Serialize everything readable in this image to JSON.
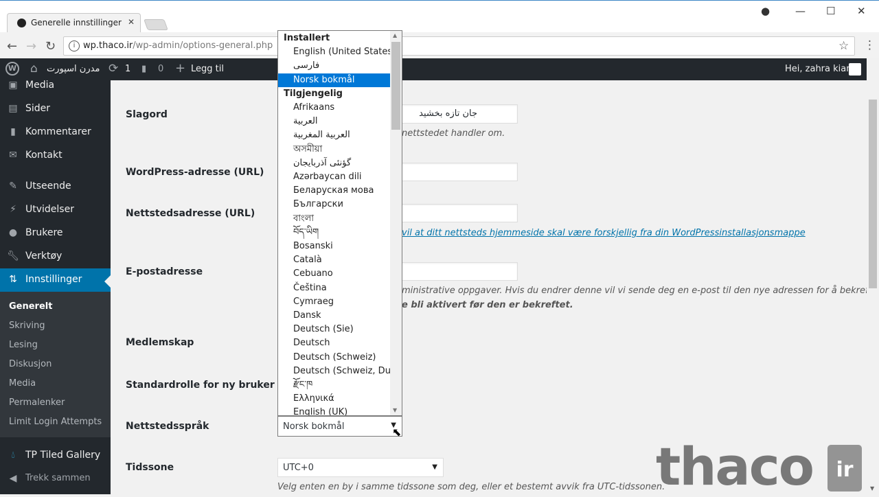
{
  "browser": {
    "tab_title": "Generelle innstillinger ‹ ",
    "url_host": "wp.thaco.ir",
    "url_path": "/wp-admin/options-general.php"
  },
  "adminbar": {
    "site_name": "مدرن اسپورت",
    "updates": "1",
    "comments": "0",
    "add_new": "Legg til",
    "greeting": "Hei, zahra kiani"
  },
  "sidebar": {
    "items": [
      {
        "label": "Media",
        "icon": "media-icon"
      },
      {
        "label": "Sider",
        "icon": "page-icon"
      },
      {
        "label": "Kommentarer",
        "icon": "comment-icon"
      },
      {
        "label": "Kontakt",
        "icon": "mail-icon"
      },
      {
        "label": "Utseende",
        "icon": "brush-icon"
      },
      {
        "label": "Utvidelser",
        "icon": "plugin-icon"
      },
      {
        "label": "Brukere",
        "icon": "user-icon"
      },
      {
        "label": "Verktøy",
        "icon": "wrench-icon"
      },
      {
        "label": "Innstillinger",
        "icon": "settings-icon"
      }
    ],
    "submenu": [
      "Generelt",
      "Skriving",
      "Lesing",
      "Diskusjon",
      "Media",
      "Permalenker",
      "Limit Login Attempts"
    ],
    "gallery": "TP Tiled Gallery",
    "collapse": "Trekk sammen"
  },
  "form": {
    "tagline_label": "Slagord",
    "tagline_value": "جان تازه بخشید",
    "tagline_desc": "nettstedet handler om.",
    "wpurl_label": "WordPress-adresse (URL)",
    "siteurl_label": "Nettstedsadresse (URL)",
    "siteurl_desc_link": "vil at ditt nettsteds hjemmeside skal være forskjellig fra din WordPressinstallasjonsmappe",
    "email_label": "E-postadresse",
    "email_desc_1": "ministrative oppgaver. Hvis du endrer denne vil vi sende deg en e-post til den nye adressen for å bekrefte",
    "email_desc_2": "e bli aktivert før den er bekreftet.",
    "membership_label": "Medlemskap",
    "role_label": "Standardrolle for ny bruker",
    "language_label": "Nettstedsspråk",
    "language_value": "Norsk bokmål",
    "timezone_label": "Tidssone",
    "timezone_value": "UTC+0",
    "timezone_desc": "Velg enten en by i samme tidssone som deg, eller et bestemt avvik fra UTC-tidssonen."
  },
  "dropdown": {
    "installed_group": "Installert",
    "installed": [
      "English (United States)",
      "فارسی",
      "Norsk bokmål"
    ],
    "selected": "Norsk bokmål",
    "available_group": "Tilgjengelig",
    "available": [
      "Afrikaans",
      "العربية",
      "العربية المغربية",
      "অসমীয়া",
      "گؤنئی آذربایجان",
      "Azərbaycan dili",
      "Беларуская мова",
      "Български",
      "বাংলা",
      "བོད་ཡིག",
      "Bosanski",
      "Català",
      "Cebuano",
      "Čeština",
      "Cymraeg",
      "Dansk",
      "Deutsch (Sie)",
      "Deutsch",
      "Deutsch (Schweiz)",
      "Deutsch (Schweiz, Du)",
      "རྫོང་ཁ",
      "Ελληνικά",
      "English (UK)"
    ],
    "highlight_color": "#0078d7"
  },
  "watermark": {
    "text": "thaco",
    "badge": "ir"
  },
  "colors": {
    "adminbar": "#23282d",
    "active_menu": "#0073aa",
    "link": "#0073aa"
  }
}
